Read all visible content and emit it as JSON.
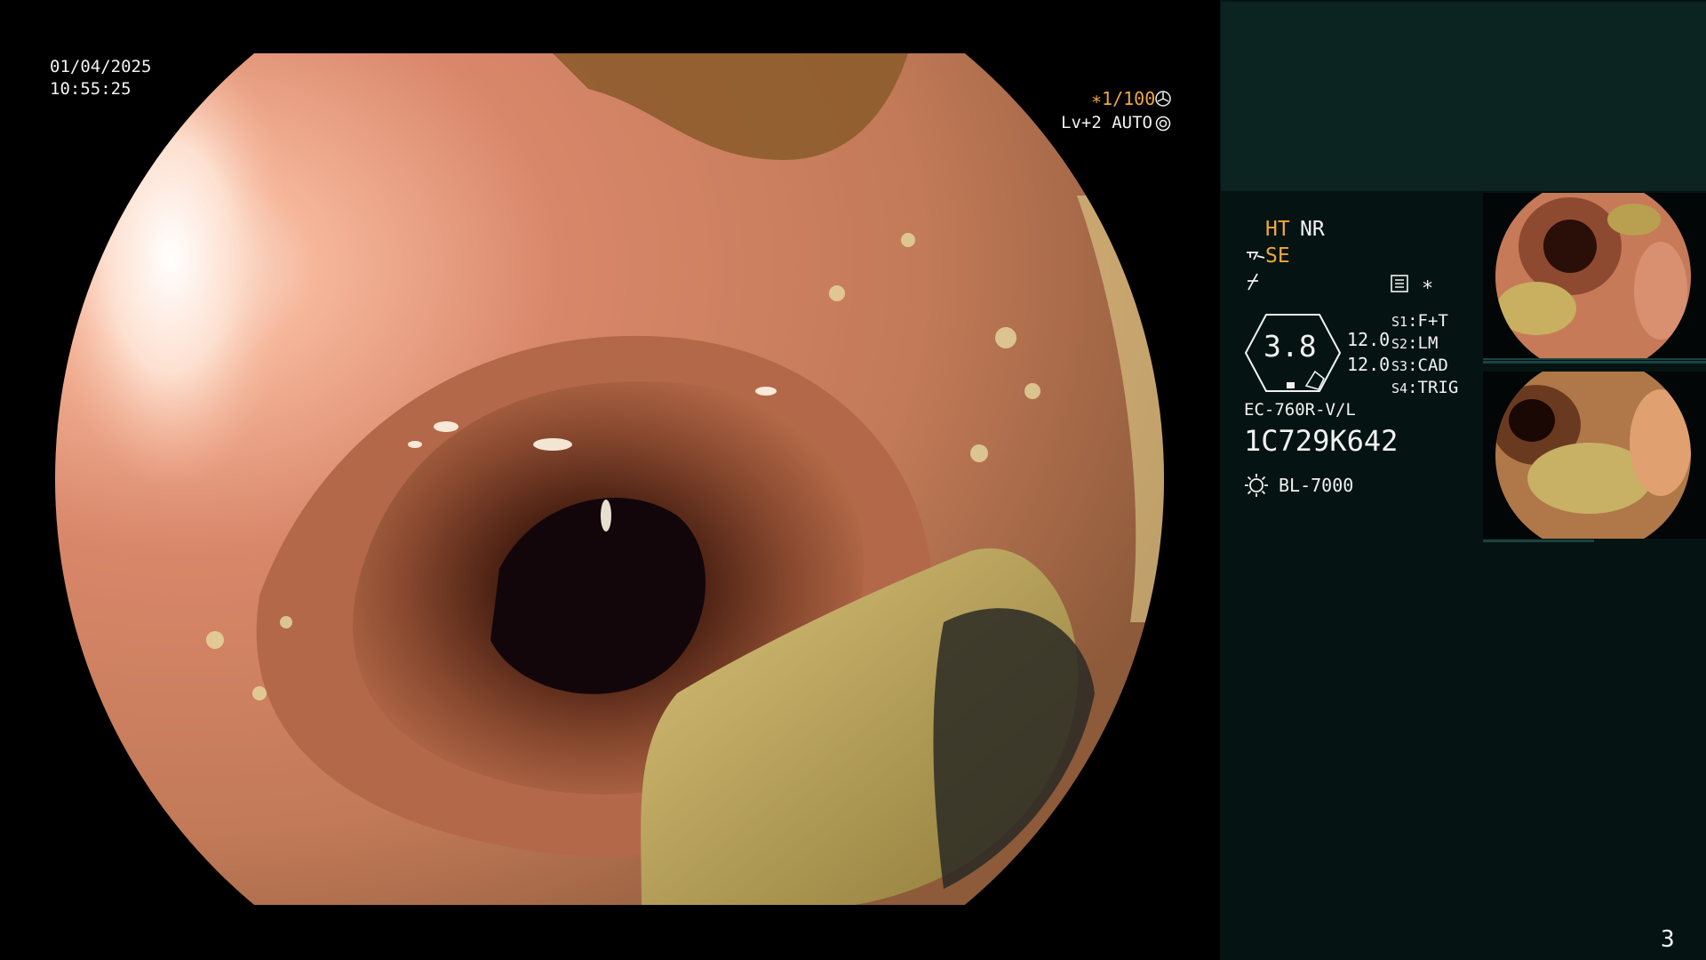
{
  "overlay": {
    "date": "01/04/2025",
    "time": "10:55:25",
    "shutter_star": "∗",
    "shutter": "1/100",
    "level": "Lv+2 AUTO"
  },
  "settings": {
    "ht": "HT",
    "nr": "NR",
    "se": "SE",
    "star": "∗",
    "scope_value": "3.8",
    "value_1": "12.0",
    "value_2": "12.0",
    "switches": [
      {
        "key": "S1",
        "sep": ":",
        "value": "F+T"
      },
      {
        "key": "S2",
        "sep": ":",
        "value": "LM"
      },
      {
        "key": "S3",
        "sep": ":",
        "value": "CAD"
      },
      {
        "key": "S4",
        "sep": ":",
        "value": "TRIG"
      }
    ],
    "scope_model": "EC-760R-V/L",
    "serial": "1C729K642",
    "light_source": "BL-7000"
  },
  "page_number": "3",
  "colors": {
    "highlight": "#f0a83a",
    "panel_bg": "#051413",
    "panel_top_bg": "#0b2422"
  },
  "icons": [
    "fan-icon",
    "scope-settings-icon",
    "se-prefix-icon",
    "slash-icon",
    "memory-icon",
    "sun-icon"
  ]
}
